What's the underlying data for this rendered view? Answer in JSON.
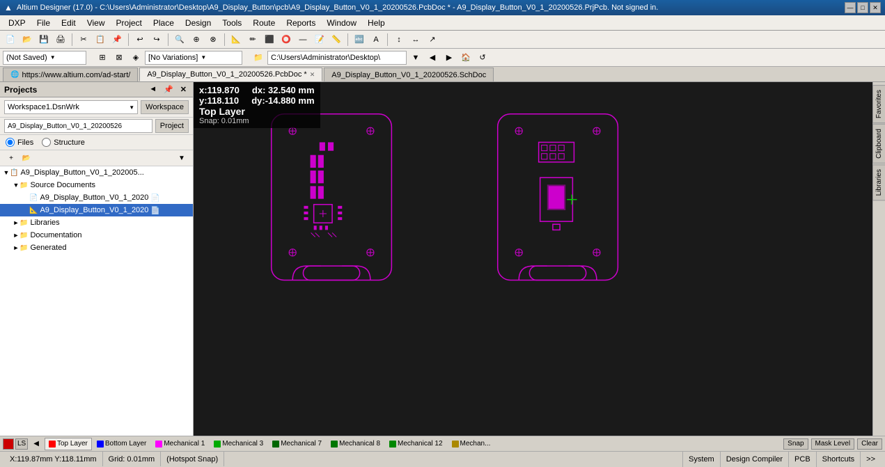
{
  "titleBar": {
    "logo": "▲",
    "title": "Altium Designer (17.0) - C:\\Users\\Administrator\\Desktop\\A9_Display_Button\\pcb\\A9_Display_Button_V0_1_20200526.PcbDoc * - A9_Display_Button_V0_1_20200526.PrjPcb. Not signed in.",
    "minimize": "—",
    "maximize": "□",
    "close": "✕"
  },
  "menuBar": {
    "items": [
      "DXP",
      "File",
      "Edit",
      "View",
      "Project",
      "Place",
      "Design",
      "Tools",
      "Route",
      "Reports",
      "Window",
      "Help"
    ]
  },
  "toolbar1": {
    "buttons": [
      "📄",
      "📂",
      "💾",
      "🖨",
      "✂",
      "📋",
      "📌",
      "↩",
      "↪",
      "🔍",
      "🔎",
      "⊕",
      "⊗"
    ]
  },
  "toolbar2": {
    "notSaved": "(Not Saved)",
    "noVariations": "[No Variations]",
    "pathDisplay": "C:\\Users\\Administrator\\Desktop\\"
  },
  "tabs": {
    "items": [
      {
        "id": "start",
        "label": "https://www.altium.com/ad-start/",
        "active": false,
        "hasClose": false,
        "isUrl": true
      },
      {
        "id": "pcbdoc",
        "label": "A9_Display_Button_V0_1_20200526.PcbDoc *",
        "active": true,
        "hasClose": true,
        "isUrl": false
      },
      {
        "id": "schdoc",
        "label": "A9_Display_Button_V0_1_20200526.SchDoc",
        "active": false,
        "hasClose": false,
        "isUrl": false
      }
    ]
  },
  "leftPanel": {
    "title": "Projects",
    "collapseIcon": "◄",
    "pinIcon": "📌",
    "closeIcon": "✕",
    "workspace": {
      "value": "Workspace1.DsnWrk",
      "buttonLabel": "Workspace"
    },
    "project": {
      "value": "A9_Display_Button_V0_1_20200526",
      "buttonLabel": "Project"
    },
    "radioGroup": {
      "options": [
        "Files",
        "Structure"
      ],
      "selected": "Files"
    },
    "tree": [
      {
        "indent": 0,
        "expand": "▼",
        "icon": "📋",
        "label": "A9_Display_Button_V0_1_202005...",
        "selected": false,
        "level": 0
      },
      {
        "indent": 1,
        "expand": "▼",
        "icon": "📁",
        "label": "Source Documents",
        "selected": false,
        "level": 1
      },
      {
        "indent": 2,
        "expand": " ",
        "icon": "📄",
        "label": "A9_Display_Button_V0_1_2020",
        "selected": false,
        "level": 2,
        "hasSuffix": true
      },
      {
        "indent": 2,
        "expand": " ",
        "icon": "📐",
        "label": "A9_Display_Button_V0_1_2020",
        "selected": true,
        "level": 2,
        "hasSuffix": true
      },
      {
        "indent": 1,
        "expand": "►",
        "icon": "📁",
        "label": "Libraries",
        "selected": false,
        "level": 1
      },
      {
        "indent": 1,
        "expand": "►",
        "icon": "📁",
        "label": "Documentation",
        "selected": false,
        "level": 1
      },
      {
        "indent": 1,
        "expand": "►",
        "icon": "📁",
        "label": "Generated",
        "selected": false,
        "level": 1
      }
    ]
  },
  "canvas": {
    "coordX": "x:119.870",
    "coordY": "y:118.110",
    "dxLabel": "dx: 32.540 mm",
    "dyLabel": "dy:-14.880 mm",
    "layerLabel": "Top Layer",
    "snapLabel": "Snap: 0.01mm"
  },
  "rightSidebar": {
    "tabs": [
      "Favorites",
      "Clipboard",
      "Libraries"
    ]
  },
  "layerBar": {
    "layers": [
      {
        "id": "top",
        "label": "Top Layer",
        "color": "#ff0000",
        "active": true
      },
      {
        "id": "bottom",
        "label": "Bottom Layer",
        "color": "#0000ff",
        "active": false
      },
      {
        "id": "mech1",
        "label": "Mechanical 1",
        "color": "#ff00ff",
        "active": false
      },
      {
        "id": "mech3",
        "label": "Mechanical 3",
        "color": "#00aa00",
        "active": false
      },
      {
        "id": "mech7",
        "label": "Mechanical 7",
        "color": "#006600",
        "active": false
      },
      {
        "id": "mech8",
        "label": "Mechanical 8",
        "color": "#007700",
        "active": false
      },
      {
        "id": "mech12",
        "label": "Mechanical 12",
        "color": "#008800",
        "active": false
      },
      {
        "id": "mechan",
        "label": "Mechan...",
        "color": "#aa8800",
        "active": false
      }
    ],
    "snapLabel": "Snap",
    "maskLevelLabel": "Mask Level",
    "clearLabel": "Clear"
  },
  "statusBar": {
    "coords": "X:119.87mm Y:118.11mm",
    "grid": "Grid: 0.01mm",
    "hotspot": "(Hotspot Snap)",
    "system": "System",
    "designCompiler": "Design Compiler",
    "pcb": "PCB",
    "shortcuts": "Shortcuts",
    "arrowRight": ">>"
  }
}
